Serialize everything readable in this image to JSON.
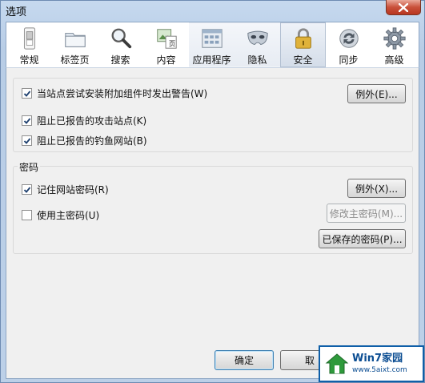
{
  "window": {
    "title": "选项"
  },
  "tabs": [
    {
      "label": "常规",
      "icon": "switch-icon"
    },
    {
      "label": "标签页",
      "icon": "folder-tabs-icon"
    },
    {
      "label": "搜索",
      "icon": "magnifier-icon"
    },
    {
      "label": "内容",
      "icon": "page-icon"
    },
    {
      "label": "应用程序",
      "icon": "applications-icon"
    },
    {
      "label": "隐私",
      "icon": "mask-icon"
    },
    {
      "label": "安全",
      "icon": "padlock-icon"
    },
    {
      "label": "同步",
      "icon": "sync-icon"
    },
    {
      "label": "高级",
      "icon": "gear-icon"
    }
  ],
  "active_tab": "安全",
  "security": {
    "warn_addons": {
      "label": "当站点尝试安装附加组件时发出警告(W)",
      "checked": true
    },
    "exceptions_label": "例外(E)...",
    "block_attack": {
      "label": "阻止已报告的攻击站点(K)",
      "checked": true
    },
    "block_forgery": {
      "label": "阻止已报告的钓鱼网站(B)",
      "checked": true
    }
  },
  "passwords": {
    "group_title": "密码",
    "remember": {
      "label": "记住网站密码(R)",
      "checked": true
    },
    "exceptions_label": "例外(X)...",
    "master": {
      "label": "使用主密码(U)",
      "checked": false
    },
    "change_master_label": "修改主密码(M)...",
    "saved_label": "已保存的密码(P)..."
  },
  "footer": {
    "ok_label": "确定",
    "cancel_label": "取"
  },
  "watermark": {
    "main": "Win7家园",
    "url": "www.5aixt.com"
  }
}
